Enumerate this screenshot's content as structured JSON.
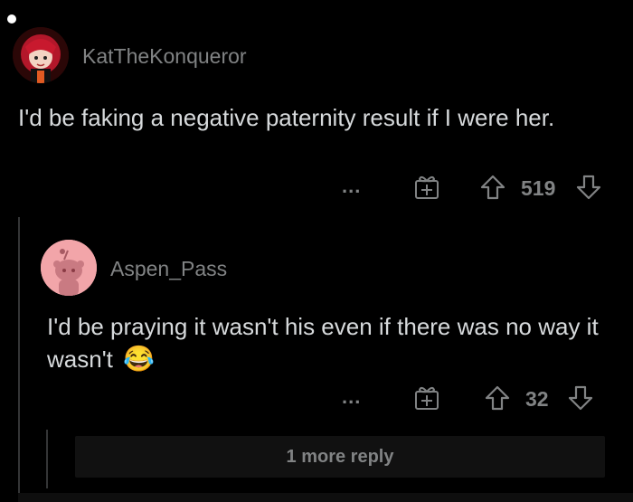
{
  "comments": [
    {
      "username": "KatTheKonqueror",
      "text": "I'd be faking a negative paternity result if I were her.",
      "score": "519",
      "more_label": "...",
      "avatar_icon": "red-haired-avatar-icon"
    },
    {
      "username": "Aspen_Pass",
      "text": "I'd be praying it wasn't his even if there was no way it wasn't",
      "emoji": "😂",
      "score": "32",
      "more_label": "...",
      "avatar_icon": "snoo-avatar-icon"
    }
  ],
  "more_replies_label": "1 more reply",
  "colors": {
    "background": "#000000",
    "text": "#d7dadc",
    "muted": "#818384",
    "thread_line": "#343536"
  }
}
